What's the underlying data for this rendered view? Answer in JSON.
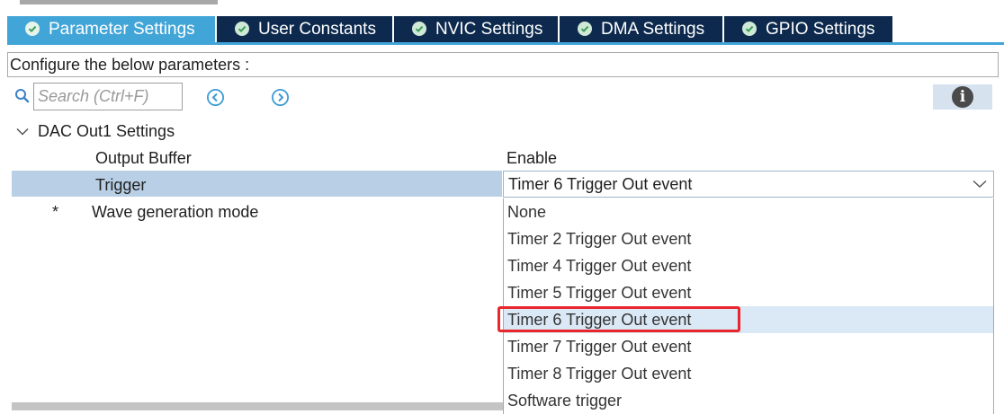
{
  "tabs": [
    {
      "label": "Parameter Settings",
      "active": true
    },
    {
      "label": "User Constants",
      "active": false
    },
    {
      "label": "NVIC Settings",
      "active": false
    },
    {
      "label": "DMA Settings",
      "active": false
    },
    {
      "label": "GPIO Settings",
      "active": false
    }
  ],
  "config_label": "Configure the below parameters :",
  "search": {
    "placeholder": "Search (Ctrl+F)"
  },
  "group": {
    "label": "DAC Out1 Settings"
  },
  "params": {
    "output_buffer": {
      "label": "Output Buffer",
      "value": "Enable"
    },
    "trigger": {
      "label": "Trigger",
      "value": "Timer 6 Trigger Out event"
    },
    "wave": {
      "marker": "*",
      "label": "Wave generation mode"
    }
  },
  "dropdown": {
    "options": [
      "None",
      "Timer 2 Trigger Out event",
      "Timer 4 Trigger Out event",
      "Timer 5 Trigger Out event",
      "Timer 6 Trigger Out event",
      "Timer 7 Trigger Out event",
      "Timer 8 Trigger Out event",
      "Software trigger"
    ],
    "selected_index": 4
  },
  "colors": {
    "tab_active": "#42a5d8",
    "tab_inactive": "#0d2a4e",
    "row_selected": "#b8cfe5",
    "option_selected": "#dbe8f5",
    "annotation": "#e8262b"
  },
  "icons": {
    "tab": "check-circle-icon",
    "search": "search-icon",
    "prev": "chevron-left-circle-icon",
    "next": "chevron-right-circle-icon",
    "info": "info-icon",
    "expand": "chevron-down-icon",
    "dropdown": "chevron-down-icon"
  }
}
